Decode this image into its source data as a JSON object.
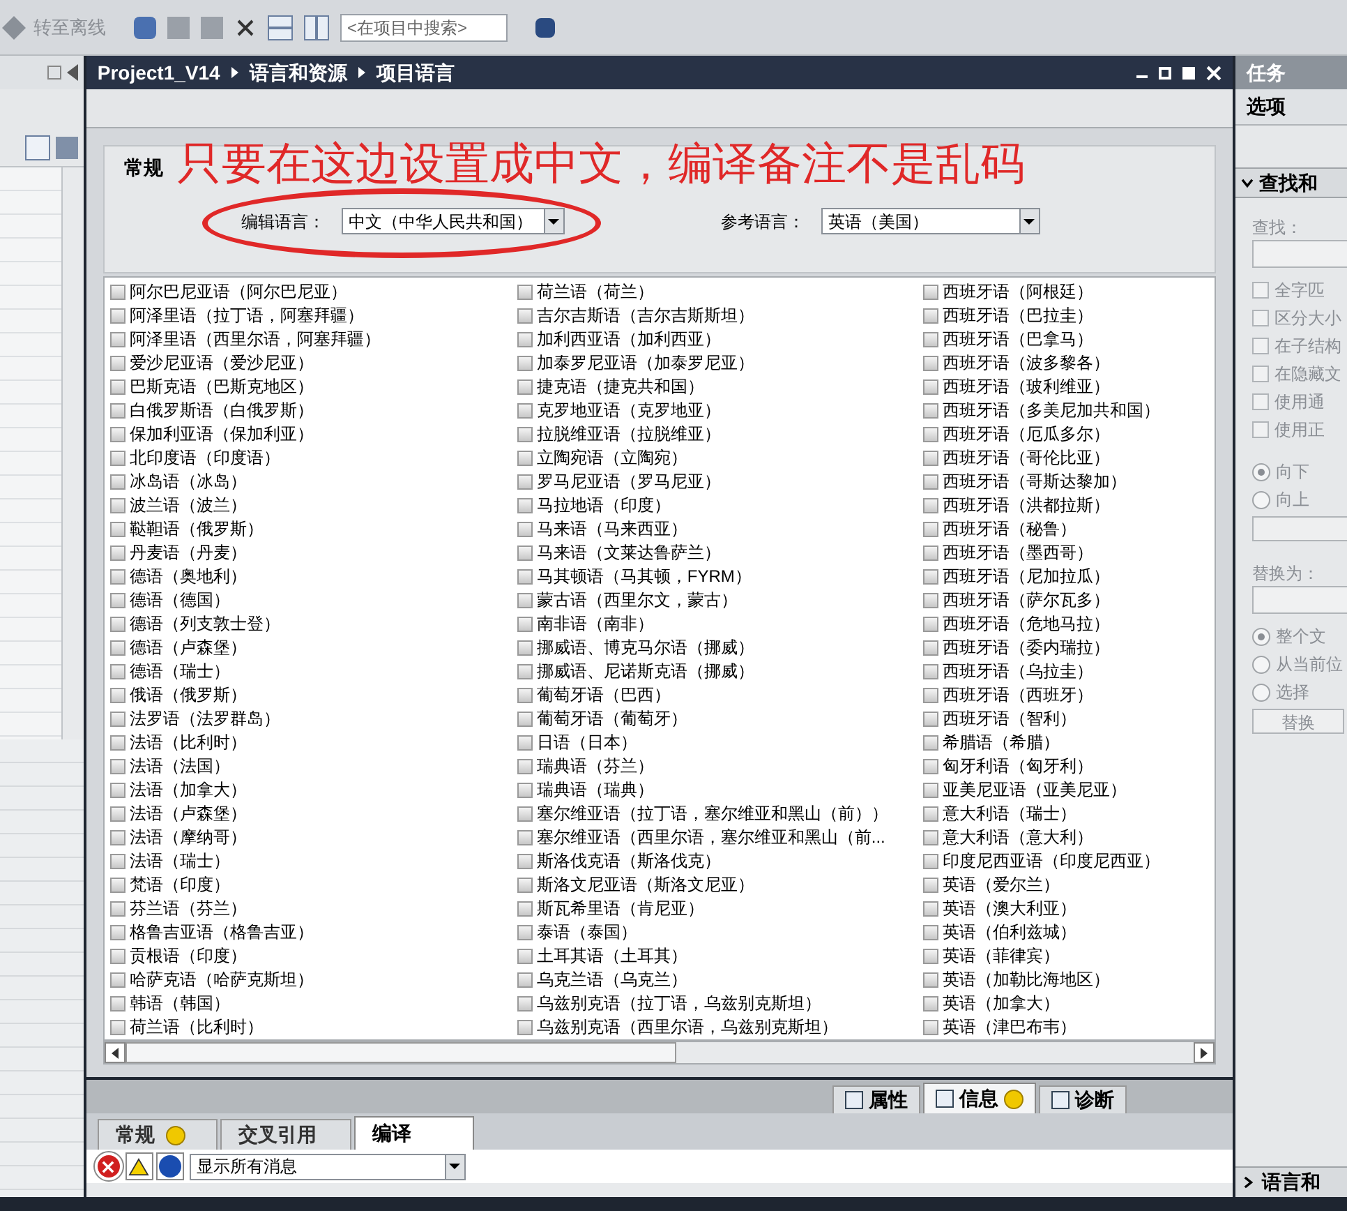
{
  "toolbar": {
    "go_offline": "转至离线",
    "search": {
      "placeholder": "<在项目中搜索>"
    }
  },
  "editor": {
    "breadcrumb": [
      "Project1_V14",
      "语言和资源",
      "项目语言"
    ],
    "general": {
      "title": "常规",
      "editing_language": {
        "label": "编辑语言：",
        "value": "中文（中华人民共和国）"
      },
      "reference_language": {
        "label": "参考语言：",
        "value": "英语（美国）"
      }
    },
    "annotation": {
      "text": "只要在这边设置成中文，编译备注不是乱码"
    },
    "language_columns": [
      [
        {
          "label": "阿尔巴尼亚语（阿尔巴尼亚）",
          "checked": false
        },
        {
          "label": "阿泽里语（拉丁语，阿塞拜疆）",
          "checked": false
        },
        {
          "label": "阿泽里语（西里尔语，阿塞拜疆）",
          "checked": false
        },
        {
          "label": "爱沙尼亚语（爱沙尼亚）",
          "checked": false
        },
        {
          "label": "巴斯克语（巴斯克地区）",
          "checked": false
        },
        {
          "label": "白俄罗斯语（白俄罗斯）",
          "checked": false
        },
        {
          "label": "保加利亚语（保加利亚）",
          "checked": false
        },
        {
          "label": "北印度语（印度语）",
          "checked": false
        },
        {
          "label": "冰岛语（冰岛）",
          "checked": false
        },
        {
          "label": "波兰语（波兰）",
          "checked": false
        },
        {
          "label": "鞑靼语（俄罗斯）",
          "checked": false
        },
        {
          "label": "丹麦语（丹麦）",
          "checked": false
        },
        {
          "label": "德语（奥地利）",
          "checked": false
        },
        {
          "label": "德语（德国）",
          "checked": false
        },
        {
          "label": "德语（列支敦士登）",
          "checked": false
        },
        {
          "label": "德语（卢森堡）",
          "checked": false
        },
        {
          "label": "德语（瑞士）",
          "checked": false
        },
        {
          "label": "俄语（俄罗斯）",
          "checked": false
        },
        {
          "label": "法罗语（法罗群岛）",
          "checked": false
        },
        {
          "label": "法语（比利时）",
          "checked": false
        },
        {
          "label": "法语（法国）",
          "checked": false
        },
        {
          "label": "法语（加拿大）",
          "checked": false
        },
        {
          "label": "法语（卢森堡）",
          "checked": false
        },
        {
          "label": "法语（摩纳哥）",
          "checked": false
        },
        {
          "label": "法语（瑞士）",
          "checked": false
        },
        {
          "label": "梵语（印度）",
          "checked": false
        },
        {
          "label": "芬兰语（芬兰）",
          "checked": false
        },
        {
          "label": "格鲁吉亚语（格鲁吉亚）",
          "checked": false
        },
        {
          "label": "贡根语（印度）",
          "checked": false
        },
        {
          "label": "哈萨克语（哈萨克斯坦）",
          "checked": false
        },
        {
          "label": "韩语（韩国）",
          "checked": false
        },
        {
          "label": "荷兰语（比利时）",
          "checked": false
        }
      ],
      [
        {
          "label": "荷兰语（荷兰）",
          "checked": false
        },
        {
          "label": "吉尔吉斯语（吉尔吉斯斯坦）",
          "checked": false
        },
        {
          "label": "加利西亚语（加利西亚）",
          "checked": false
        },
        {
          "label": "加泰罗尼亚语（加泰罗尼亚）",
          "checked": false
        },
        {
          "label": "捷克语（捷克共和国）",
          "checked": false
        },
        {
          "label": "克罗地亚语（克罗地亚）",
          "checked": false
        },
        {
          "label": "拉脱维亚语（拉脱维亚）",
          "checked": false
        },
        {
          "label": "立陶宛语（立陶宛）",
          "checked": false
        },
        {
          "label": "罗马尼亚语（罗马尼亚）",
          "checked": false
        },
        {
          "label": "马拉地语（印度）",
          "checked": false
        },
        {
          "label": "马来语（马来西亚）",
          "checked": false
        },
        {
          "label": "马来语（文莱达鲁萨兰）",
          "checked": false
        },
        {
          "label": "马其顿语（马其顿，FYRM）",
          "checked": false
        },
        {
          "label": "蒙古语（西里尔文，蒙古）",
          "checked": false
        },
        {
          "label": "南非语（南非）",
          "checked": false
        },
        {
          "label": "挪威语、博克马尔语（挪威）",
          "checked": false
        },
        {
          "label": "挪威语、尼诺斯克语（挪威）",
          "checked": false
        },
        {
          "label": "葡萄牙语（巴西）",
          "checked": false
        },
        {
          "label": "葡萄牙语（葡萄牙）",
          "checked": false
        },
        {
          "label": "日语（日本）",
          "checked": false
        },
        {
          "label": "瑞典语（芬兰）",
          "checked": false
        },
        {
          "label": "瑞典语（瑞典）",
          "checked": false
        },
        {
          "label": "塞尔维亚语（拉丁语，塞尔维亚和黑山（前））",
          "checked": false
        },
        {
          "label": "塞尔维亚语（西里尔语，塞尔维亚和黑山（前...",
          "checked": false
        },
        {
          "label": "斯洛伐克语（斯洛伐克）",
          "checked": false
        },
        {
          "label": "斯洛文尼亚语（斯洛文尼亚）",
          "checked": false
        },
        {
          "label": "斯瓦希里语（肯尼亚）",
          "checked": false
        },
        {
          "label": "泰语（泰国）",
          "checked": false
        },
        {
          "label": "土耳其语（土耳其）",
          "checked": false
        },
        {
          "label": "乌克兰语（乌克兰）",
          "checked": false
        },
        {
          "label": "乌兹别克语（拉丁语，乌兹别克斯坦）",
          "checked": false
        },
        {
          "label": "乌兹别克语（西里尔语，乌兹别克斯坦）",
          "checked": false
        }
      ],
      [
        {
          "label": "西班牙语（阿根廷）",
          "checked": false
        },
        {
          "label": "西班牙语（巴拉圭）",
          "checked": false
        },
        {
          "label": "西班牙语（巴拿马）",
          "checked": false
        },
        {
          "label": "西班牙语（波多黎各）",
          "checked": false
        },
        {
          "label": "西班牙语（玻利维亚）",
          "checked": false
        },
        {
          "label": "西班牙语（多美尼加共和国）",
          "checked": false
        },
        {
          "label": "西班牙语（厄瓜多尔）",
          "checked": false
        },
        {
          "label": "西班牙语（哥伦比亚）",
          "checked": false
        },
        {
          "label": "西班牙语（哥斯达黎加）",
          "checked": false
        },
        {
          "label": "西班牙语（洪都拉斯）",
          "checked": false
        },
        {
          "label": "西班牙语（秘鲁）",
          "checked": false
        },
        {
          "label": "西班牙语（墨西哥）",
          "checked": false
        },
        {
          "label": "西班牙语（尼加拉瓜）",
          "checked": false
        },
        {
          "label": "西班牙语（萨尔瓦多）",
          "checked": false
        },
        {
          "label": "西班牙语（危地马拉）",
          "checked": false
        },
        {
          "label": "西班牙语（委内瑞拉）",
          "checked": false
        },
        {
          "label": "西班牙语（乌拉圭）",
          "checked": false
        },
        {
          "label": "西班牙语（西班牙）",
          "checked": false
        },
        {
          "label": "西班牙语（智利）",
          "checked": false
        },
        {
          "label": "希腊语（希腊）",
          "checked": false
        },
        {
          "label": "匈牙利语（匈牙利）",
          "checked": false
        },
        {
          "label": "亚美尼亚语（亚美尼亚）",
          "checked": false
        },
        {
          "label": "意大利语（瑞士）",
          "checked": false
        },
        {
          "label": "意大利语（意大利）",
          "checked": false
        },
        {
          "label": "印度尼西亚语（印度尼西亚）",
          "checked": false
        },
        {
          "label": "英语（爱尔兰）",
          "checked": false
        },
        {
          "label": "英语（澳大利亚）",
          "checked": false
        },
        {
          "label": "英语（伯利兹城）",
          "checked": false
        },
        {
          "label": "英语（菲律宾）",
          "checked": false
        },
        {
          "label": "英语（加勒比海地区）",
          "checked": false
        },
        {
          "label": "英语（加拿大）",
          "checked": false
        },
        {
          "label": "英语（津巴布韦）",
          "checked": false
        }
      ]
    ]
  },
  "inspector": {
    "tabs": [
      {
        "label": "属性",
        "selected": false,
        "info": false
      },
      {
        "label": "信息",
        "selected": true,
        "info": true
      },
      {
        "label": "诊断",
        "selected": false,
        "info": false
      }
    ],
    "subtabs": [
      {
        "label": "常规",
        "selected": false,
        "info": true
      },
      {
        "label": "交叉引用",
        "selected": false,
        "info": false
      },
      {
        "label": "编译",
        "selected": true,
        "info": false
      }
    ],
    "filter": {
      "value": "显示所有消息"
    }
  },
  "task_panel": {
    "title": "任务",
    "section": "选项",
    "find_replace": {
      "title": "查找和",
      "find_label": "查找：",
      "options": [
        {
          "label": "全字匹",
          "checked": false
        },
        {
          "label": "区分大小",
          "checked": false
        },
        {
          "label": "在子结构",
          "checked": false
        },
        {
          "label": "在隐藏文",
          "checked": false
        },
        {
          "label": "使用通",
          "checked": false
        },
        {
          "label": "使用正",
          "checked": false
        }
      ],
      "directions": [
        {
          "label": "向下",
          "selected": true
        },
        {
          "label": "向上",
          "selected": false
        }
      ],
      "replace_label": "替换为：",
      "scopes": [
        {
          "label": "整个文",
          "selected": true
        },
        {
          "label": "从当前位",
          "selected": false
        },
        {
          "label": "选择",
          "selected": false
        }
      ],
      "replace_button": "替换"
    },
    "languages_section": "语言和"
  }
}
